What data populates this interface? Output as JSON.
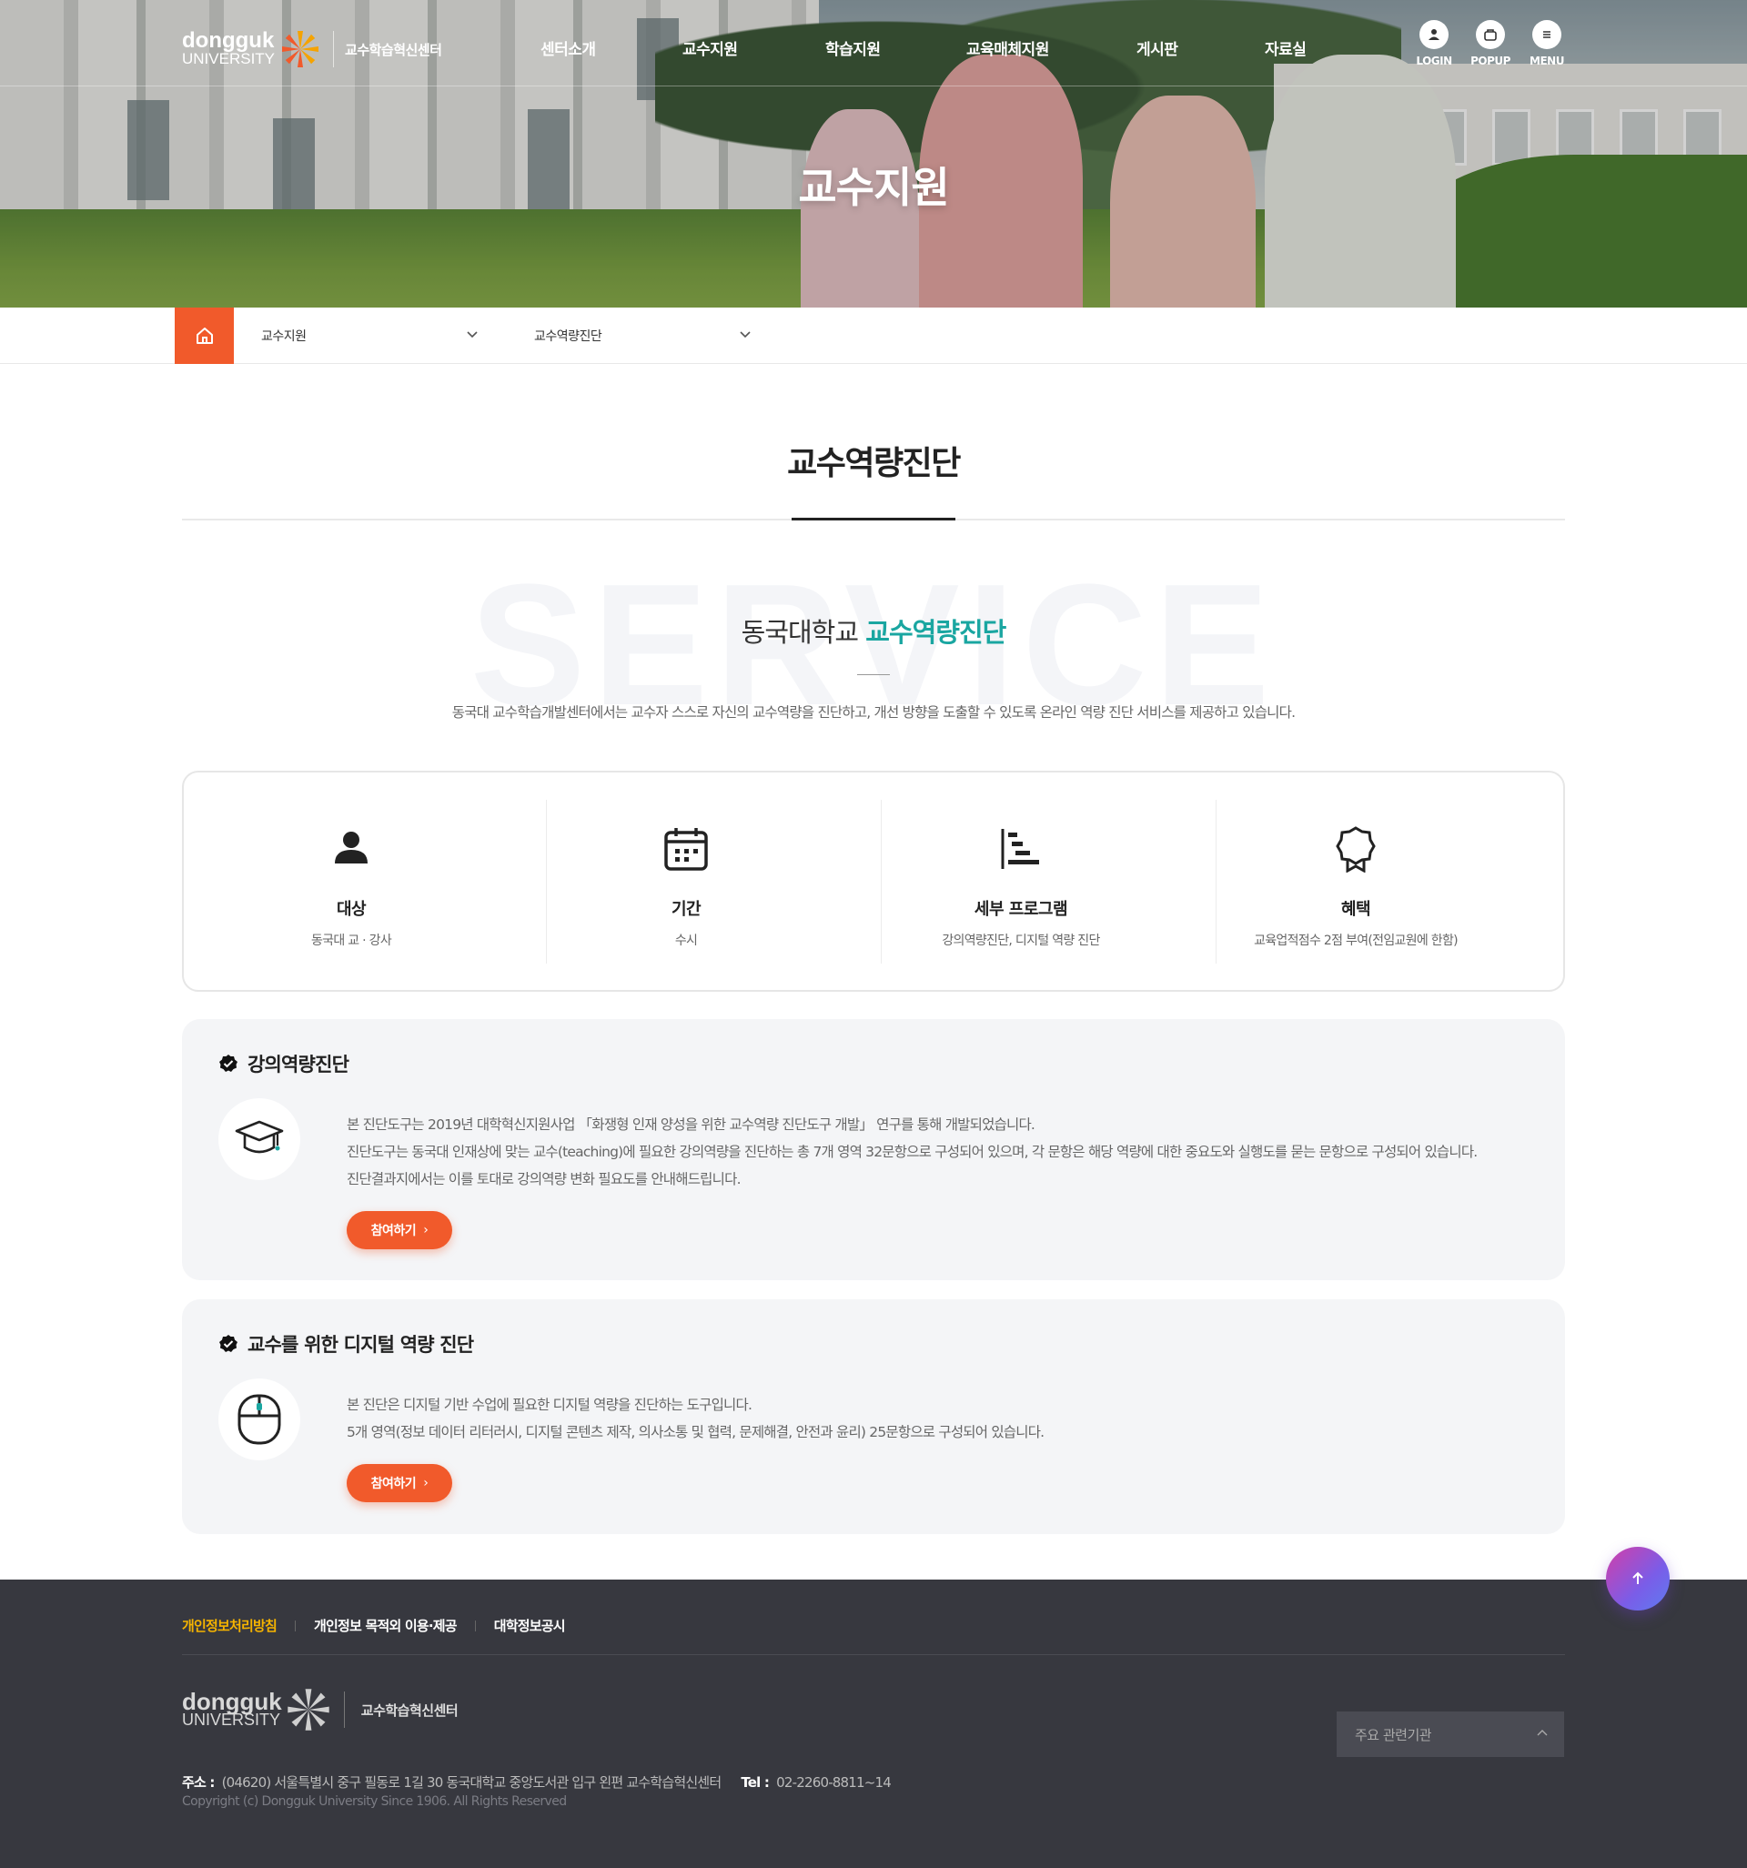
{
  "header": {
    "logo_name": "dongguk",
    "logo_university": "UNIVERSITY",
    "center_name": "교수학습혁신센터",
    "nav": [
      "센터소개",
      "교수지원",
      "학습지원",
      "교육매체지원",
      "게시판",
      "자료실"
    ],
    "utils": [
      {
        "label": "LOGIN",
        "icon": "user-icon"
      },
      {
        "label": "POPUP",
        "icon": "popup-icon"
      },
      {
        "label": "MENU",
        "icon": "menu-icon"
      }
    ]
  },
  "hero": {
    "title": "교수지원"
  },
  "breadcrumb": {
    "level1": "교수지원",
    "level2": "교수역량진단"
  },
  "page": {
    "title": "교수역량진단"
  },
  "intro": {
    "bg_word": "SERVICE",
    "title_plain": "동국대학교",
    "title_highlight": "교수역량진단",
    "description": "동국대 교수학습개발센터에서는 교수자 스스로 자신의 교수역량을 진단하고, 개선 방향을 도출할 수 있도록 온라인 역량 진단 서비스를 제공하고 있습니다."
  },
  "info": [
    {
      "icon": "person-icon",
      "label": "대상",
      "value": "동국대 교 · 강사"
    },
    {
      "icon": "calendar-icon",
      "label": "기간",
      "value": "수시"
    },
    {
      "icon": "program-list-icon",
      "label": "세부 프로그램",
      "value": "강의역량진단, 디지털 역량 진단"
    },
    {
      "icon": "award-icon",
      "label": "혜택",
      "value": "교육업적점수 2점 부여(전임교원에 한함)"
    }
  ],
  "programs": [
    {
      "icon": "graduation-cap-icon",
      "title": "강의역량진단",
      "lines": [
        "본 진단도구는 2019년 대학혁신지원사업 「화쟁형 인재 양성을 위한 교수역량 진단도구 개발」 연구를 통해 개발되었습니다.",
        "진단도구는 동국대 인재상에 맞는 교수(teaching)에 필요한 강의역량을 진단하는 총 7개 영역 32문항으로 구성되어 있으며, 각 문항은 해당 역량에 대한 중요도와 실행도를 묻는 문항으로 구성되어 있습니다.",
        "진단결과지에서는 이를 토대로 강의역량 변화 필요도를 안내해드립니다."
      ],
      "button": "참여하기"
    },
    {
      "icon": "mouse-icon",
      "title": "교수를 위한 디지털 역량 진단",
      "lines": [
        "본 진단은 디지털 기반 수업에 필요한 디지털 역량을 진단하는 도구입니다.",
        "5개 영역(정보 데이터 리터러시, 디지털 콘텐츠 제작, 의사소통 및 협력, 문제해결, 안전과 윤리) 25문항으로 구성되어 있습니다."
      ],
      "button": "참여하기"
    }
  ],
  "footer": {
    "links": [
      "개인정보처리방침",
      "개인정보 목적외 이용·제공",
      "대학정보공시"
    ],
    "logo_name": "dongguk",
    "logo_university": "UNIVERSITY",
    "center_name": "교수학습혁신센터",
    "related_select": "주요 관련기관",
    "address_label": "주소 :",
    "address": "(04620) 서울특별시 중구 필동로 1길 30 동국대학교 중앙도서관 입구 왼편 교수학습혁신센터",
    "tel_label": "Tel :",
    "tel": "02-2260-8811~14",
    "copyright": "Copyright (c) Dongguk University Since 1906. All Rights Reserved"
  },
  "colors": {
    "accent": "#f15a2b",
    "teal": "#1aa6a1",
    "footer_bg": "#37383f",
    "link_highlight": "#f5b300"
  }
}
